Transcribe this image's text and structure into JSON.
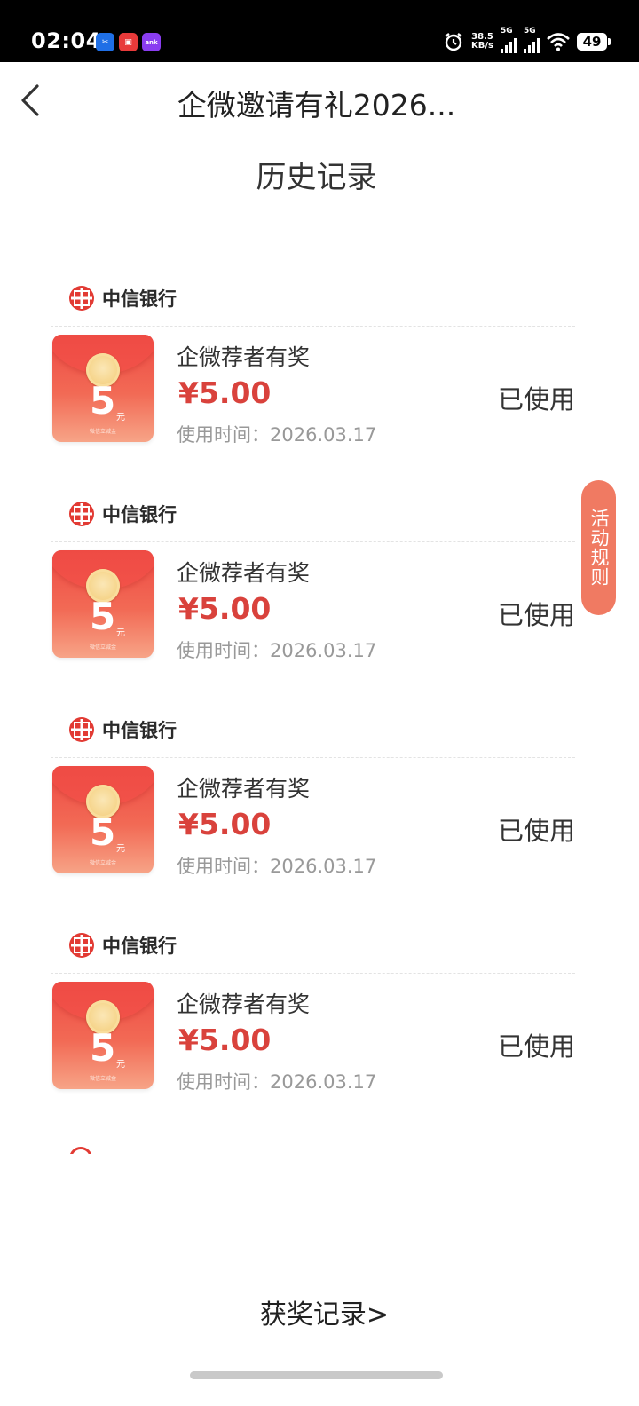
{
  "status_bar": {
    "time": "02:04",
    "apps": [
      {
        "icon": "bank-app-icon",
        "glyph": "✂",
        "color": "#1f6fe6"
      },
      {
        "icon": "shopping-app-icon",
        "glyph": "▣",
        "color": "#e83a3a"
      },
      {
        "icon": "bank-card-app-icon",
        "glyph": "ank",
        "color": "#8a3df0"
      }
    ],
    "speed_value": "38.5",
    "speed_unit": "KB/s",
    "network_label": "5G",
    "battery": "49"
  },
  "header": {
    "title": "企微邀请有礼2026...",
    "section_title": "历史记录"
  },
  "records": [
    {
      "bank": "中信银行",
      "envelope_amount": "5",
      "envelope_unit": "元",
      "envelope_sub": "微信立减金",
      "title": "企微荐者有奖",
      "amount": "¥5.00",
      "time": "使用时间：2026.03.17",
      "status": "已使用"
    },
    {
      "bank": "中信银行",
      "envelope_amount": "5",
      "envelope_unit": "元",
      "envelope_sub": "微信立减金",
      "title": "企微荐者有奖",
      "amount": "¥5.00",
      "time": "使用时间：2026.03.17",
      "status": "已使用"
    },
    {
      "bank": "中信银行",
      "envelope_amount": "5",
      "envelope_unit": "元",
      "envelope_sub": "微信立减金",
      "title": "企微荐者有奖",
      "amount": "¥5.00",
      "time": "使用时间：2026.03.17",
      "status": "已使用"
    },
    {
      "bank": "中信银行",
      "envelope_amount": "5",
      "envelope_unit": "元",
      "envelope_sub": "微信立减金",
      "title": "企微荐者有奖",
      "amount": "¥5.00",
      "time": "使用时间：2026.03.17",
      "status": "已使用"
    }
  ],
  "rules_tab": "活动规则",
  "history_link": "获奖记录>",
  "colors": {
    "accent_red": "#d9423c",
    "rules_tab": "#f07a62",
    "bank_logo": "#e23b34"
  }
}
